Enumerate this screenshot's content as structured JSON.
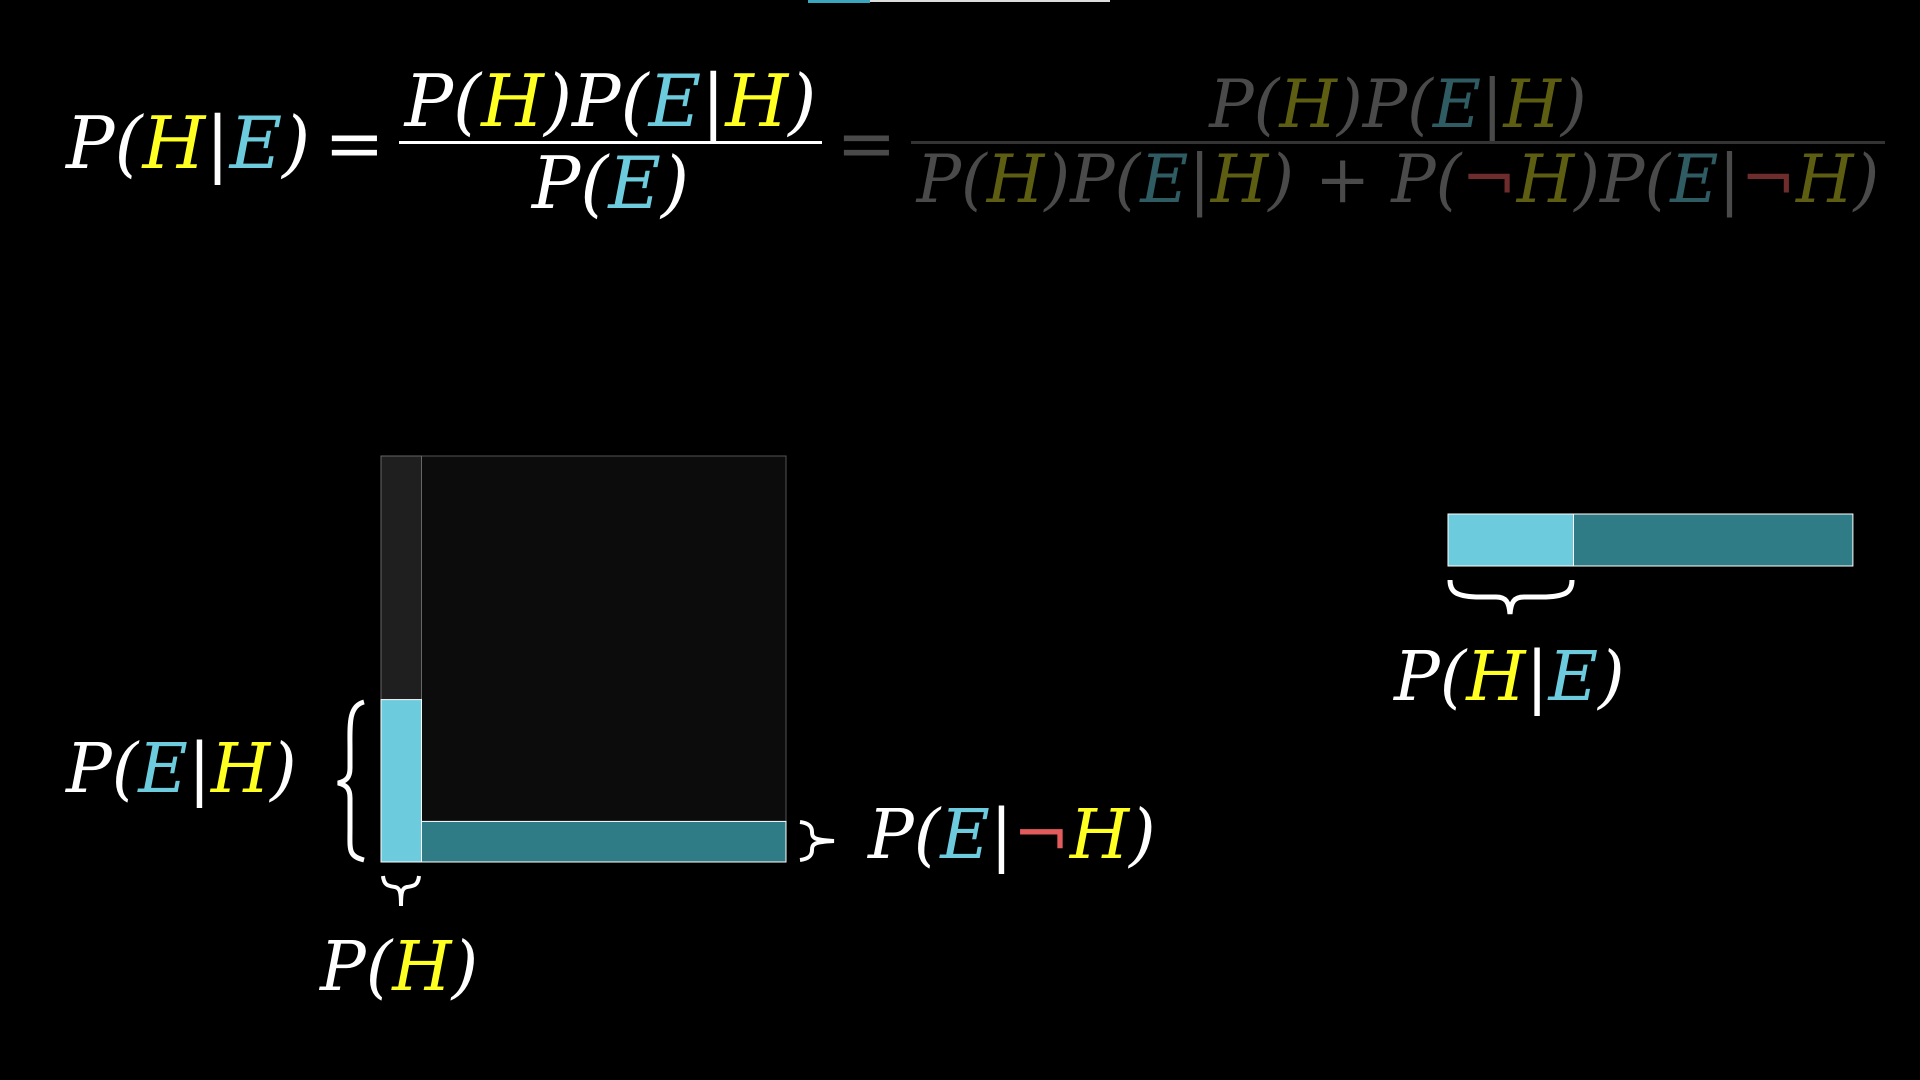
{
  "formula": {
    "lhs": [
      "P(",
      "H",
      "|",
      "E",
      ")"
    ],
    "equals": "=",
    "num1": [
      "P(",
      "H",
      ")P(",
      "E",
      "|",
      "H",
      ")"
    ],
    "den1": [
      "P(",
      "E",
      ")"
    ],
    "equals2": "=",
    "num2": [
      "P(",
      "H",
      ")P(",
      "E",
      "|",
      "H",
      ")"
    ],
    "den2": [
      "P(",
      "H",
      ")P(",
      "E",
      "|",
      "H",
      ") + P(",
      "¬",
      "H",
      ")P(",
      "E",
      "|",
      "¬",
      "H",
      ")"
    ]
  },
  "labels": {
    "p_e_given_h": [
      "P(",
      "E",
      "|",
      "H",
      ")"
    ],
    "p_h": [
      "P(",
      "H",
      ")"
    ],
    "p_e_given_not_h": [
      "P(",
      "E",
      "|",
      "¬",
      "H",
      ")"
    ],
    "p_h_given_e": [
      "P(",
      "H",
      "|",
      "E",
      ")"
    ]
  },
  "diagram": {
    "p_h": 0.1,
    "p_e_given_h": 0.4,
    "p_e_given_not_h": 0.1,
    "p_h_given_e_fraction": 0.31
  },
  "colors": {
    "hypothesis": "#ffff22",
    "evidence": "#6ccbdc",
    "evidence_dark": "#2f7c87",
    "negation": "#e35b5b",
    "square_bg": "#0c0c0c",
    "h_column_bg": "#1f1f1f"
  }
}
